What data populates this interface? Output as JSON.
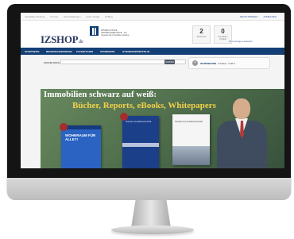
{
  "topbar": {
    "links": [
      "Immobilien Zeitung",
      "IZ Jobs",
      "Veranstaltungen",
      "Immo Verlag",
      "IZ Blog"
    ],
    "account_links": [
      "REGISTRIEREN",
      "ANMELDEN"
    ]
  },
  "header": {
    "logo_text": "IZSHOP",
    "logo_suffix": ".de",
    "logo_tagline": "WISSEN FÜR DIE IMMOBILIENBRANCHE · Ein Angebot der Immobilien Zeitung",
    "counters": [
      {
        "value": "2",
        "label": "Merkzettel"
      },
      {
        "value": "0",
        "label": "Preisalarm Produkt"
      }
    ],
    "account_link": "Ihr Leitungen ansehen"
  },
  "nav": {
    "items": [
      "STARTSEITE",
      "NEUERSCHEINUNGEN",
      "FACHBÜCHER",
      "STANDORTE",
      "IZ MARKENPORTFOLIO"
    ]
  },
  "search": {
    "label": "SUCHE NACH",
    "placeholder": "",
    "button_label": "SUCHEN"
  },
  "cart": {
    "title": "WARENKORB",
    "summary": "0 Artikel - 0,00 €"
  },
  "banner": {
    "title": "Immobilien schwarz auf weiß:",
    "subtitle": "Bücher, Reports, eBooks, Whitepapers",
    "books": [
      {
        "title": "WOHNRAUM FÜR ALLE?!"
      },
      {
        "title": "Aktuelle Immobilienwirtschaft"
      },
      {
        "title": "Handbuch Immobilienwirtschaft"
      }
    ]
  },
  "colors": {
    "nav_bg": "#143f75",
    "banner_bg": "#4d6b4a",
    "banner_title": "#ffffff",
    "banner_subtitle": "#f2d04c"
  },
  "icons": [
    "cart-icon",
    "logo-mark-icon"
  ]
}
